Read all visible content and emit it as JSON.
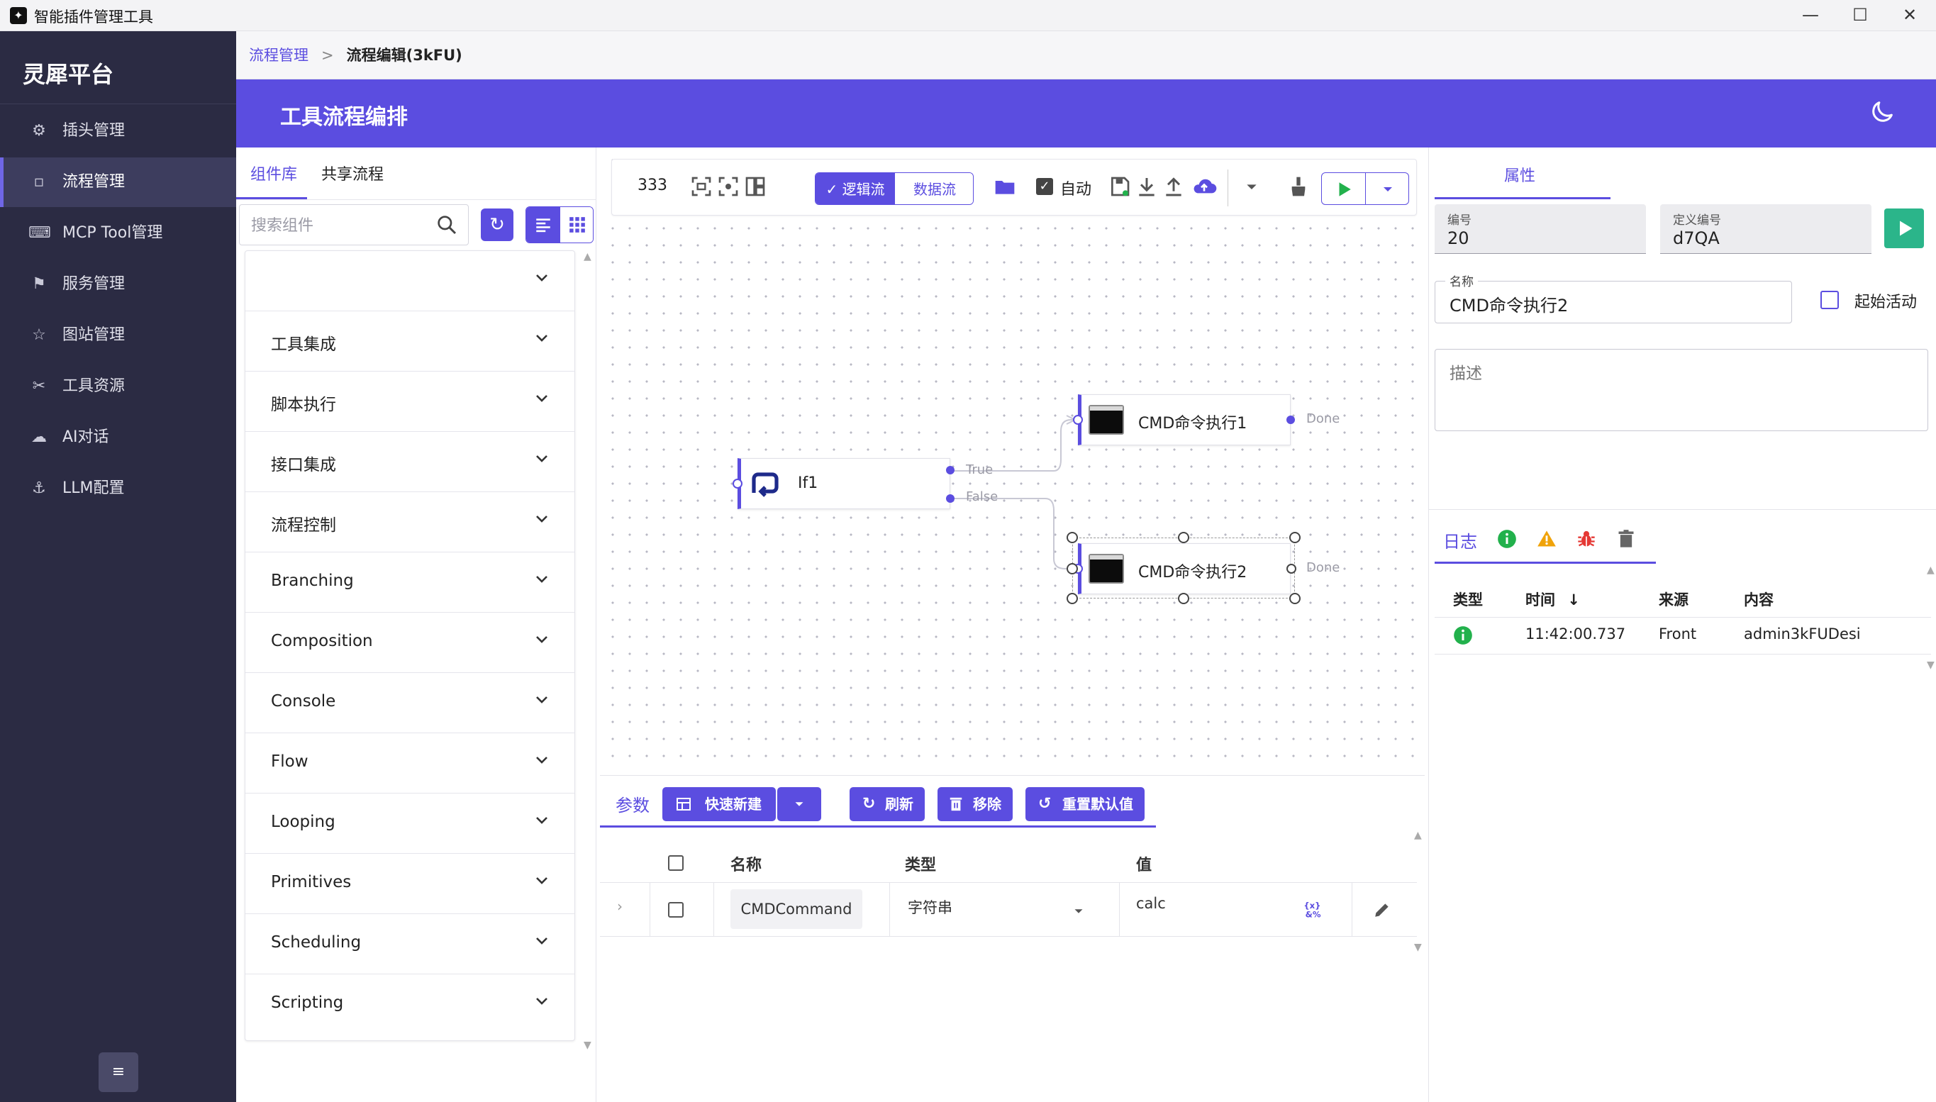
{
  "window": {
    "title": "智能插件管理工具",
    "minimize": "—",
    "maximize": "☐",
    "close": "✕"
  },
  "sidebar": {
    "brand": "灵犀平台",
    "items": [
      {
        "label": "插头管理",
        "icon": "gear-icon",
        "glyph": "⚙"
      },
      {
        "label": "流程管理",
        "icon": "square-icon",
        "glyph": "▫",
        "active": true
      },
      {
        "label": "MCP Tool管理",
        "icon": "keyboard-icon",
        "glyph": "⌨"
      },
      {
        "label": "服务管理",
        "icon": "flag-icon",
        "glyph": "⚑"
      },
      {
        "label": "图站管理",
        "icon": "star-icon",
        "glyph": "☆"
      },
      {
        "label": "工具资源",
        "icon": "tools-icon",
        "glyph": "✂"
      },
      {
        "label": "AI对话",
        "icon": "cloud-icon",
        "glyph": "☁"
      },
      {
        "label": "LLM配置",
        "icon": "anchor-icon",
        "glyph": "⚓"
      }
    ],
    "collapse_glyph": "≡"
  },
  "breadcrumb": {
    "parent": "流程管理",
    "separator": ">",
    "current": "流程编辑(3kFU)"
  },
  "header": {
    "title": "工具流程编排"
  },
  "left_panel": {
    "tabs": [
      "组件库",
      "共享流程"
    ],
    "search_placeholder": "搜索组件",
    "categories": [
      "",
      "工具集成",
      "脚本执行",
      "接口集成",
      "流程控制",
      "Branching",
      "Composition",
      "Console",
      "Flow",
      "Looping",
      "Primitives",
      "Scheduling",
      "Scripting"
    ]
  },
  "toolbar": {
    "count": "333",
    "logic_flow": "逻辑流",
    "data_flow": "数据流",
    "auto_label": "自动"
  },
  "flow": {
    "nodes": [
      {
        "label": "If1"
      },
      {
        "label": "CMD命令执行1"
      },
      {
        "label": "CMD命令执行2"
      }
    ],
    "ports": {
      "true": "True",
      "false": "False",
      "done1": "Done",
      "done2": "Done"
    }
  },
  "params": {
    "tab": "参数",
    "quick_new": "快速新建",
    "refresh": "刷新",
    "remove": "移除",
    "reset": "重置默认值",
    "columns": [
      "名称",
      "类型",
      "值"
    ],
    "row": {
      "name": "CMDCommand",
      "type": "字符串",
      "value": "calc"
    }
  },
  "properties": {
    "tab": "属性",
    "id_label": "编号",
    "id_value": "20",
    "def_label": "定义编号",
    "def_value": "d7QA",
    "name_label": "名称",
    "name_value": "CMD命令执行2",
    "start_activity": "起始活动",
    "desc_placeholder": "描述"
  },
  "log": {
    "tab": "日志",
    "columns": [
      "类型",
      "时间",
      "来源",
      "内容"
    ],
    "sort_glyph": "↓",
    "rows": [
      {
        "time": "11:42:00.737",
        "source": "Front",
        "content": "admin3kFUDesi"
      }
    ]
  },
  "colors": {
    "accent": "#5b4de0",
    "sidebar": "#2b2b43",
    "run_green": "#2bb58a",
    "info_green": "#22b14c",
    "warn_orange": "#f0a30a",
    "bug_red": "#e53935"
  }
}
